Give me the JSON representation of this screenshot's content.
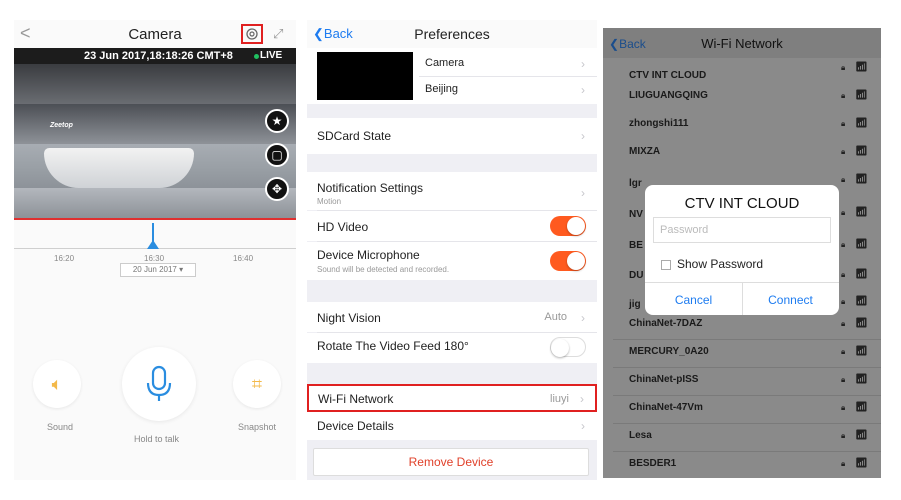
{
  "camera": {
    "back_glyph": "<",
    "title": "Camera",
    "timestamp": "23 Jun 2017,18:18:26 CMT+8",
    "live": "LIVE",
    "logo_text": "Zeetop",
    "timeline": {
      "ticks": [
        "16:20",
        "16:30",
        "16:40"
      ],
      "date": "20 Jun 2017"
    },
    "controls": {
      "sound": "Sound",
      "talk": "Hold to talk",
      "snapshot": "Snapshot"
    }
  },
  "prefs": {
    "back": "Back",
    "title": "Preferences",
    "device_name": "Camera",
    "location": "Beijing",
    "sdcard": "SDCard State",
    "notification": "Notification Settings",
    "notification_sub": "Motion",
    "hd_video": "HD Video",
    "hd_video_on": true,
    "mic": "Device Microphone",
    "mic_sub": "Sound will be detected and recorded.",
    "mic_on": true,
    "night_vision": "Night Vision",
    "night_vision_value": "Auto",
    "rotate": "Rotate The Video Feed 180°",
    "rotate_on": false,
    "wifi": "Wi-Fi Network",
    "wifi_value": "liuyi",
    "device_details": "Device Details",
    "remove": "Remove Device"
  },
  "wifi": {
    "back": "Back",
    "title": "Wi-Fi Network",
    "networks": [
      "CTV INT CLOUD",
      "LIUGUANGQING",
      "zhongshi111",
      "MIXZA",
      "lgr",
      "NV",
      "BE",
      "DU",
      "jig",
      "ChinaNet-7DAZ",
      "MERCURY_0A20",
      "ChinaNet-pISS",
      "ChinaNet-47Vm",
      "Lesa",
      "BESDER1"
    ],
    "dialog": {
      "title": "CTV INT CLOUD",
      "placeholder": "Password",
      "show_password": "Show Password",
      "cancel": "Cancel",
      "connect": "Connect"
    }
  },
  "colors": {
    "accent_blue": "#1e7cf0",
    "toggle_orange": "#ff5a1f",
    "highlight_red": "#e02020"
  }
}
